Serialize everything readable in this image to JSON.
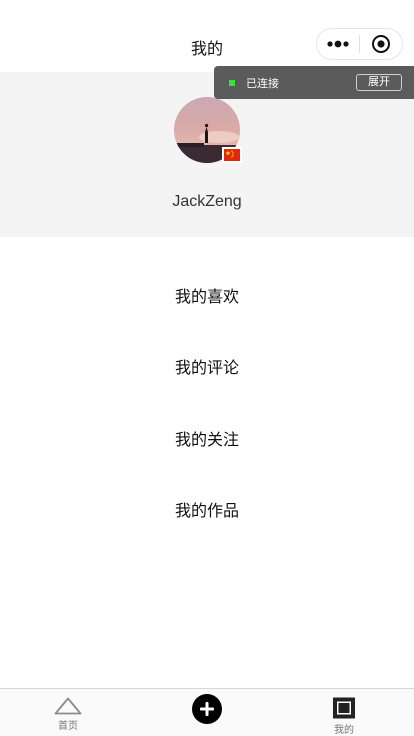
{
  "navbar": {
    "title": "我的",
    "capsule": {
      "more_icon": "more-dots-icon",
      "close_icon": "target-circle-icon"
    }
  },
  "debug": {
    "status": "已连接",
    "expand_label": "展开",
    "status_color": "#3ce23c"
  },
  "profile": {
    "username": "JackZeng",
    "avatar_icon": "avatar-sunset-silhouette",
    "badge_icon": "china-flag-icon"
  },
  "menu": {
    "items": [
      {
        "label": "我的喜欢"
      },
      {
        "label": "我的评论"
      },
      {
        "label": "我的关注"
      },
      {
        "label": "我的作品"
      }
    ]
  },
  "tabbar": {
    "items": [
      {
        "label": "首页",
        "icon": "triangle-home-icon"
      },
      {
        "label": "",
        "icon": "plus-circle-icon"
      },
      {
        "label": "我的",
        "icon": "square-profile-icon"
      }
    ]
  }
}
